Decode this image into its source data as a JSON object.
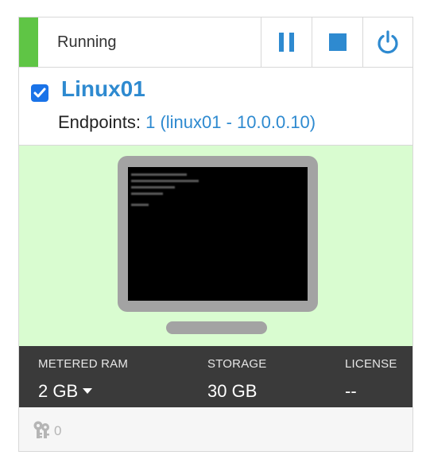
{
  "status": {
    "label": "Running",
    "color": "#5fc545"
  },
  "controls": {
    "pause_icon": "pause-icon",
    "stop_icon": "stop-icon",
    "power_icon": "power-icon",
    "icon_color": "#2e8ad0"
  },
  "vm": {
    "selected": true,
    "name": "Linux01",
    "endpoints_label": "Endpoints:",
    "endpoints_value": "1 (linux01 - 10.0.0.10)"
  },
  "screen": {
    "background": "#d9fcd0",
    "icon": "monitor-icon"
  },
  "stats": {
    "ram_label": "METERED RAM",
    "ram_value": "2 GB",
    "storage_label": "STORAGE",
    "storage_value": "30 GB",
    "license_label": "LICENSE",
    "license_value": "--"
  },
  "footer": {
    "keys_icon": "keys-icon",
    "keys_count": "0"
  }
}
